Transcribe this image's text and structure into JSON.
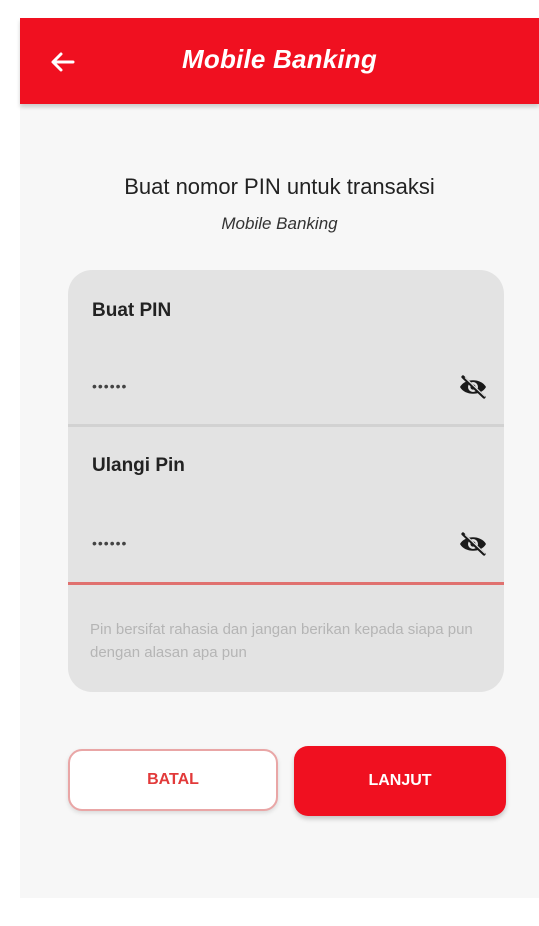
{
  "colors": {
    "primary": "#f01020",
    "card_bg": "#e3e3e3",
    "active_underline": "#e0716f",
    "hint_text": "#b5b5b5"
  },
  "appbar": {
    "back_icon": "arrow-left-icon",
    "title": "Mobile Banking"
  },
  "header": {
    "headline": "Buat nomor PIN untuk transaksi",
    "subline": "Mobile Banking"
  },
  "form": {
    "create_pin": {
      "label": "Buat PIN",
      "value": "••••••",
      "toggle_icon": "eye-off-icon"
    },
    "repeat_pin": {
      "label": "Ulangi Pin",
      "value": "••••••",
      "toggle_icon": "eye-off-icon"
    },
    "hint": "Pin bersifat rahasia dan jangan berikan kepada siapa pun dengan alasan apa pun"
  },
  "actions": {
    "cancel_label": "BATAL",
    "next_label": "LANJUT"
  }
}
